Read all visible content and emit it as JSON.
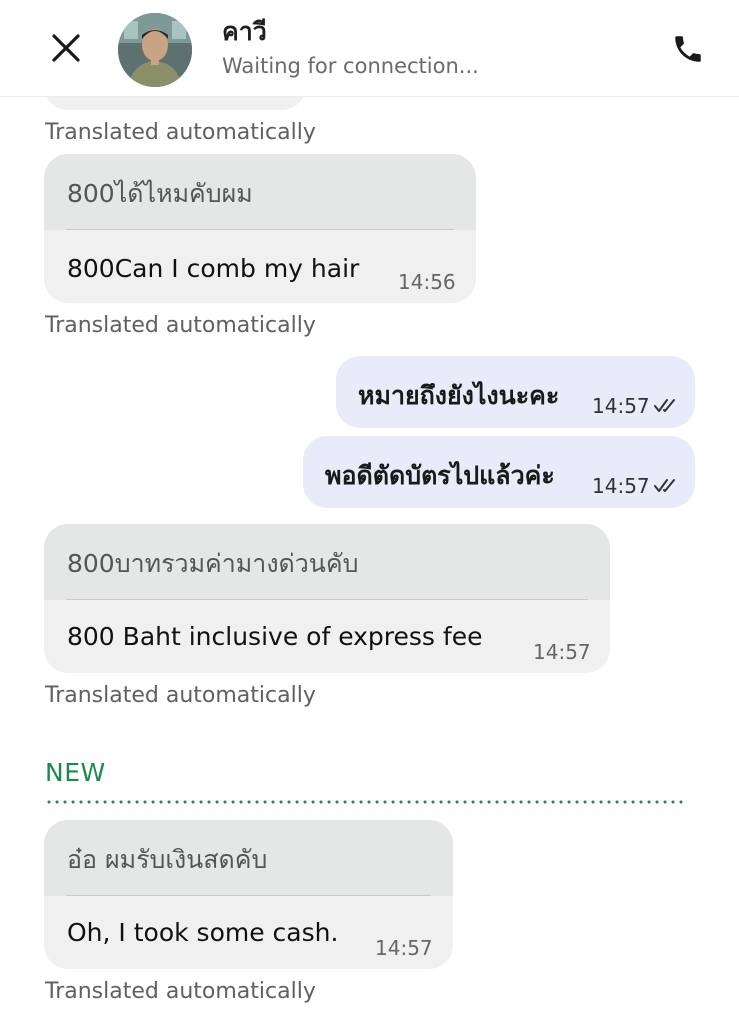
{
  "header": {
    "contact_name": "คาวี",
    "status": "Waiting for connection..."
  },
  "messages": [
    {
      "direction": "incoming",
      "original": "800ได้ไหมคับผม",
      "translation": "800Can I comb my hair",
      "time": "14:56",
      "footer": "Translated automatically"
    },
    {
      "direction": "outgoing",
      "text": "หมายถึงยังไงนะคะ",
      "time": "14:57",
      "status": "read"
    },
    {
      "direction": "outgoing",
      "text": "พอดีตัดบัตรไปแล้วค่ะ",
      "time": "14:57",
      "status": "read"
    },
    {
      "direction": "incoming",
      "original": "800บาทรวมค่ามางด่วนคับ",
      "translation": "800 Baht inclusive of express fee",
      "time": "14:57",
      "footer": "Translated automatically"
    },
    {
      "direction": "incoming",
      "original": "อ๋อ ผมรับเงินสดคับ",
      "translation": "Oh, I took some cash.",
      "time": "14:57",
      "footer": "Translated automatically"
    }
  ],
  "top_footer": "Translated automatically",
  "new_divider_label": "NEW",
  "colors": {
    "incoming_bubble": "#f0f0f0",
    "original_section": "#e5e7e6",
    "outgoing_bubble": "#e9ebfa",
    "new_accent": "#1a8a55"
  },
  "icons": {
    "close": "close-icon",
    "call": "phone-icon",
    "read_status": "double-check-icon"
  }
}
